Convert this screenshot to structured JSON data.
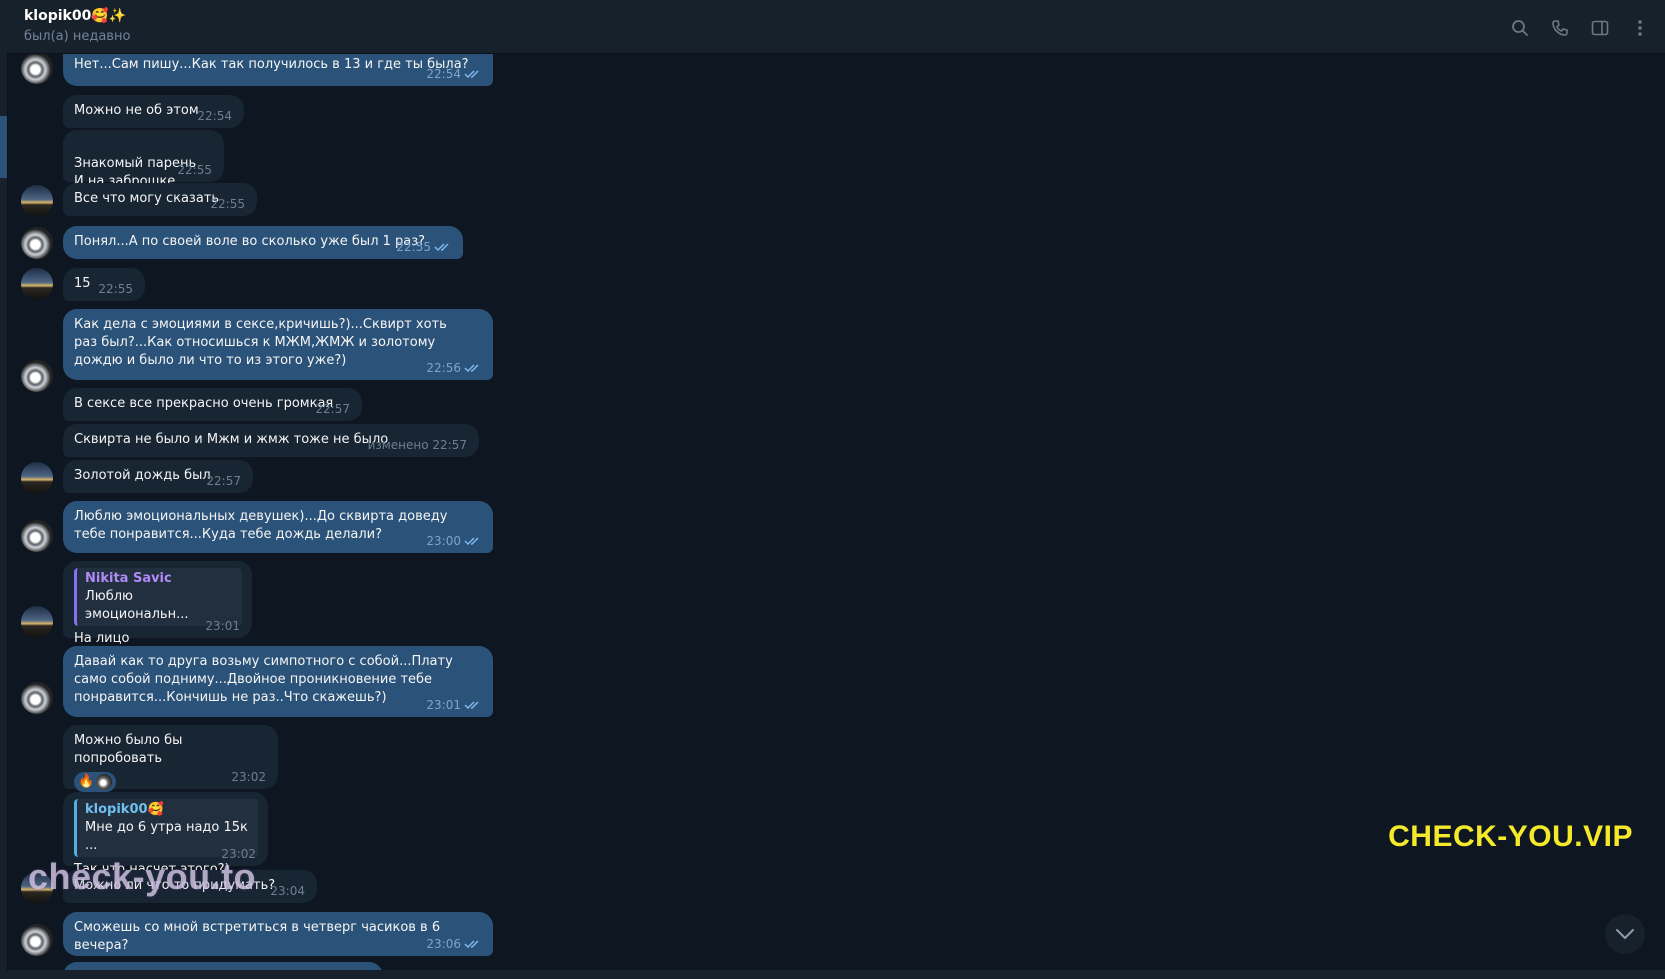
{
  "header": {
    "name": "klopik00🥰✨",
    "status": "был(а) недавно"
  },
  "icons": {
    "search": "search-icon",
    "call": "phone-icon",
    "sidebar": "sidebar-toggle-icon",
    "menu": "more-vertical-icon"
  },
  "colors": {
    "bg": "#0e1621",
    "incoming": "#182533",
    "outgoing": "#2b5278",
    "accent_reply": "#b08af7"
  },
  "messages": [
    {
      "dir": "out",
      "text": "Нет...Сам пишу...Как так получилось в 13 и где ты была?",
      "time": "22:54"
    },
    {
      "dir": "in",
      "text": "Можно не об этом",
      "time": "22:54"
    },
    {
      "dir": "in",
      "text": "Знакомый парень\nИ на заброшке",
      "time": "22:55"
    },
    {
      "dir": "in",
      "text": "Все что могу сказать",
      "time": "22:55"
    },
    {
      "dir": "out",
      "text": "Понял...А по своей воле во сколько уже был 1 раз?",
      "time": "22:55"
    },
    {
      "dir": "in",
      "text": "15",
      "time": "22:55"
    },
    {
      "dir": "out",
      "text": "Как дела с эмоциями в сексе,кричишь?)...Сквирт хоть раз был?...Как относишься к МЖМ,ЖМЖ и золотому дождю и было ли что то из этого уже?)",
      "time": "22:56"
    },
    {
      "dir": "in",
      "text": "В сексе все прекрасно очень громкая",
      "time": "22:57"
    },
    {
      "dir": "in",
      "text": "Сквирта не было и Мжм и жмж тоже не было",
      "time": "изменено 22:57"
    },
    {
      "dir": "in",
      "text": "Золотой дождь был",
      "time": "22:57"
    },
    {
      "dir": "out",
      "text": "Люблю эмоциональных девушек)...До сквирта доведу тебе понравится...Куда тебе дождь делали?",
      "time": "23:00"
    },
    {
      "dir": "in",
      "reply_name": "Nikita Savic",
      "reply_text": "Люблю эмоциональн...",
      "text": "На лицо",
      "time": "23:01"
    },
    {
      "dir": "out",
      "text": "Давай как то друга возьму симпотного с собой...Плату само собой подниму...Двойное проникновение тебе понравится...Кончишь не раз..Что скажешь?)",
      "time": "23:01"
    },
    {
      "dir": "in",
      "text": "Можно было бы попробовать",
      "time": "23:02",
      "reaction": "🔥"
    },
    {
      "dir": "in",
      "reply_name": "klopik00🥰",
      "reply_text": "Мне до 6 утра надо 15к ...",
      "text": "Так что насчет этого?)",
      "time": "23:02"
    },
    {
      "dir": "in",
      "text": "Можно ли что то придумать?",
      "time": "23:04"
    },
    {
      "dir": "out",
      "text": "Сможешь со мной встретиться в четверг часиков в 6 вечера?",
      "time": "23:06"
    }
  ],
  "watermarks": {
    "right": "CHECK-YOU.VIP",
    "left": "check-you.to"
  }
}
